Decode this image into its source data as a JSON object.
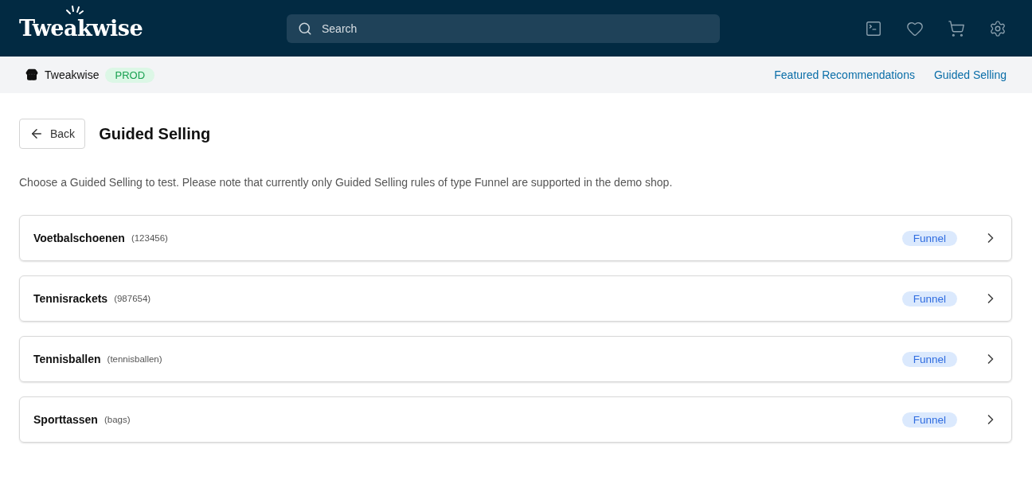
{
  "header": {
    "logo": "Tweakwise",
    "search": {
      "placeholder": "Search"
    }
  },
  "subbar": {
    "shop": "Tweakwise",
    "environment": "PROD",
    "links": [
      "Featured Recommendations",
      "Guided Selling"
    ]
  },
  "page": {
    "back": "Back",
    "title": "Guided Selling",
    "description": "Choose a Guided Selling to test. Please note that currently only Guided Selling rules of type Funnel are supported in the demo shop."
  },
  "items": [
    {
      "name": "Voetbalschoenen",
      "id": "(123456)",
      "type": "Funnel"
    },
    {
      "name": "Tennisrackets",
      "id": "(987654)",
      "type": "Funnel"
    },
    {
      "name": "Tennisballen",
      "id": "(tennisballen)",
      "type": "Funnel"
    },
    {
      "name": "Sporttassen",
      "id": "(bags)",
      "type": "Funnel"
    }
  ]
}
